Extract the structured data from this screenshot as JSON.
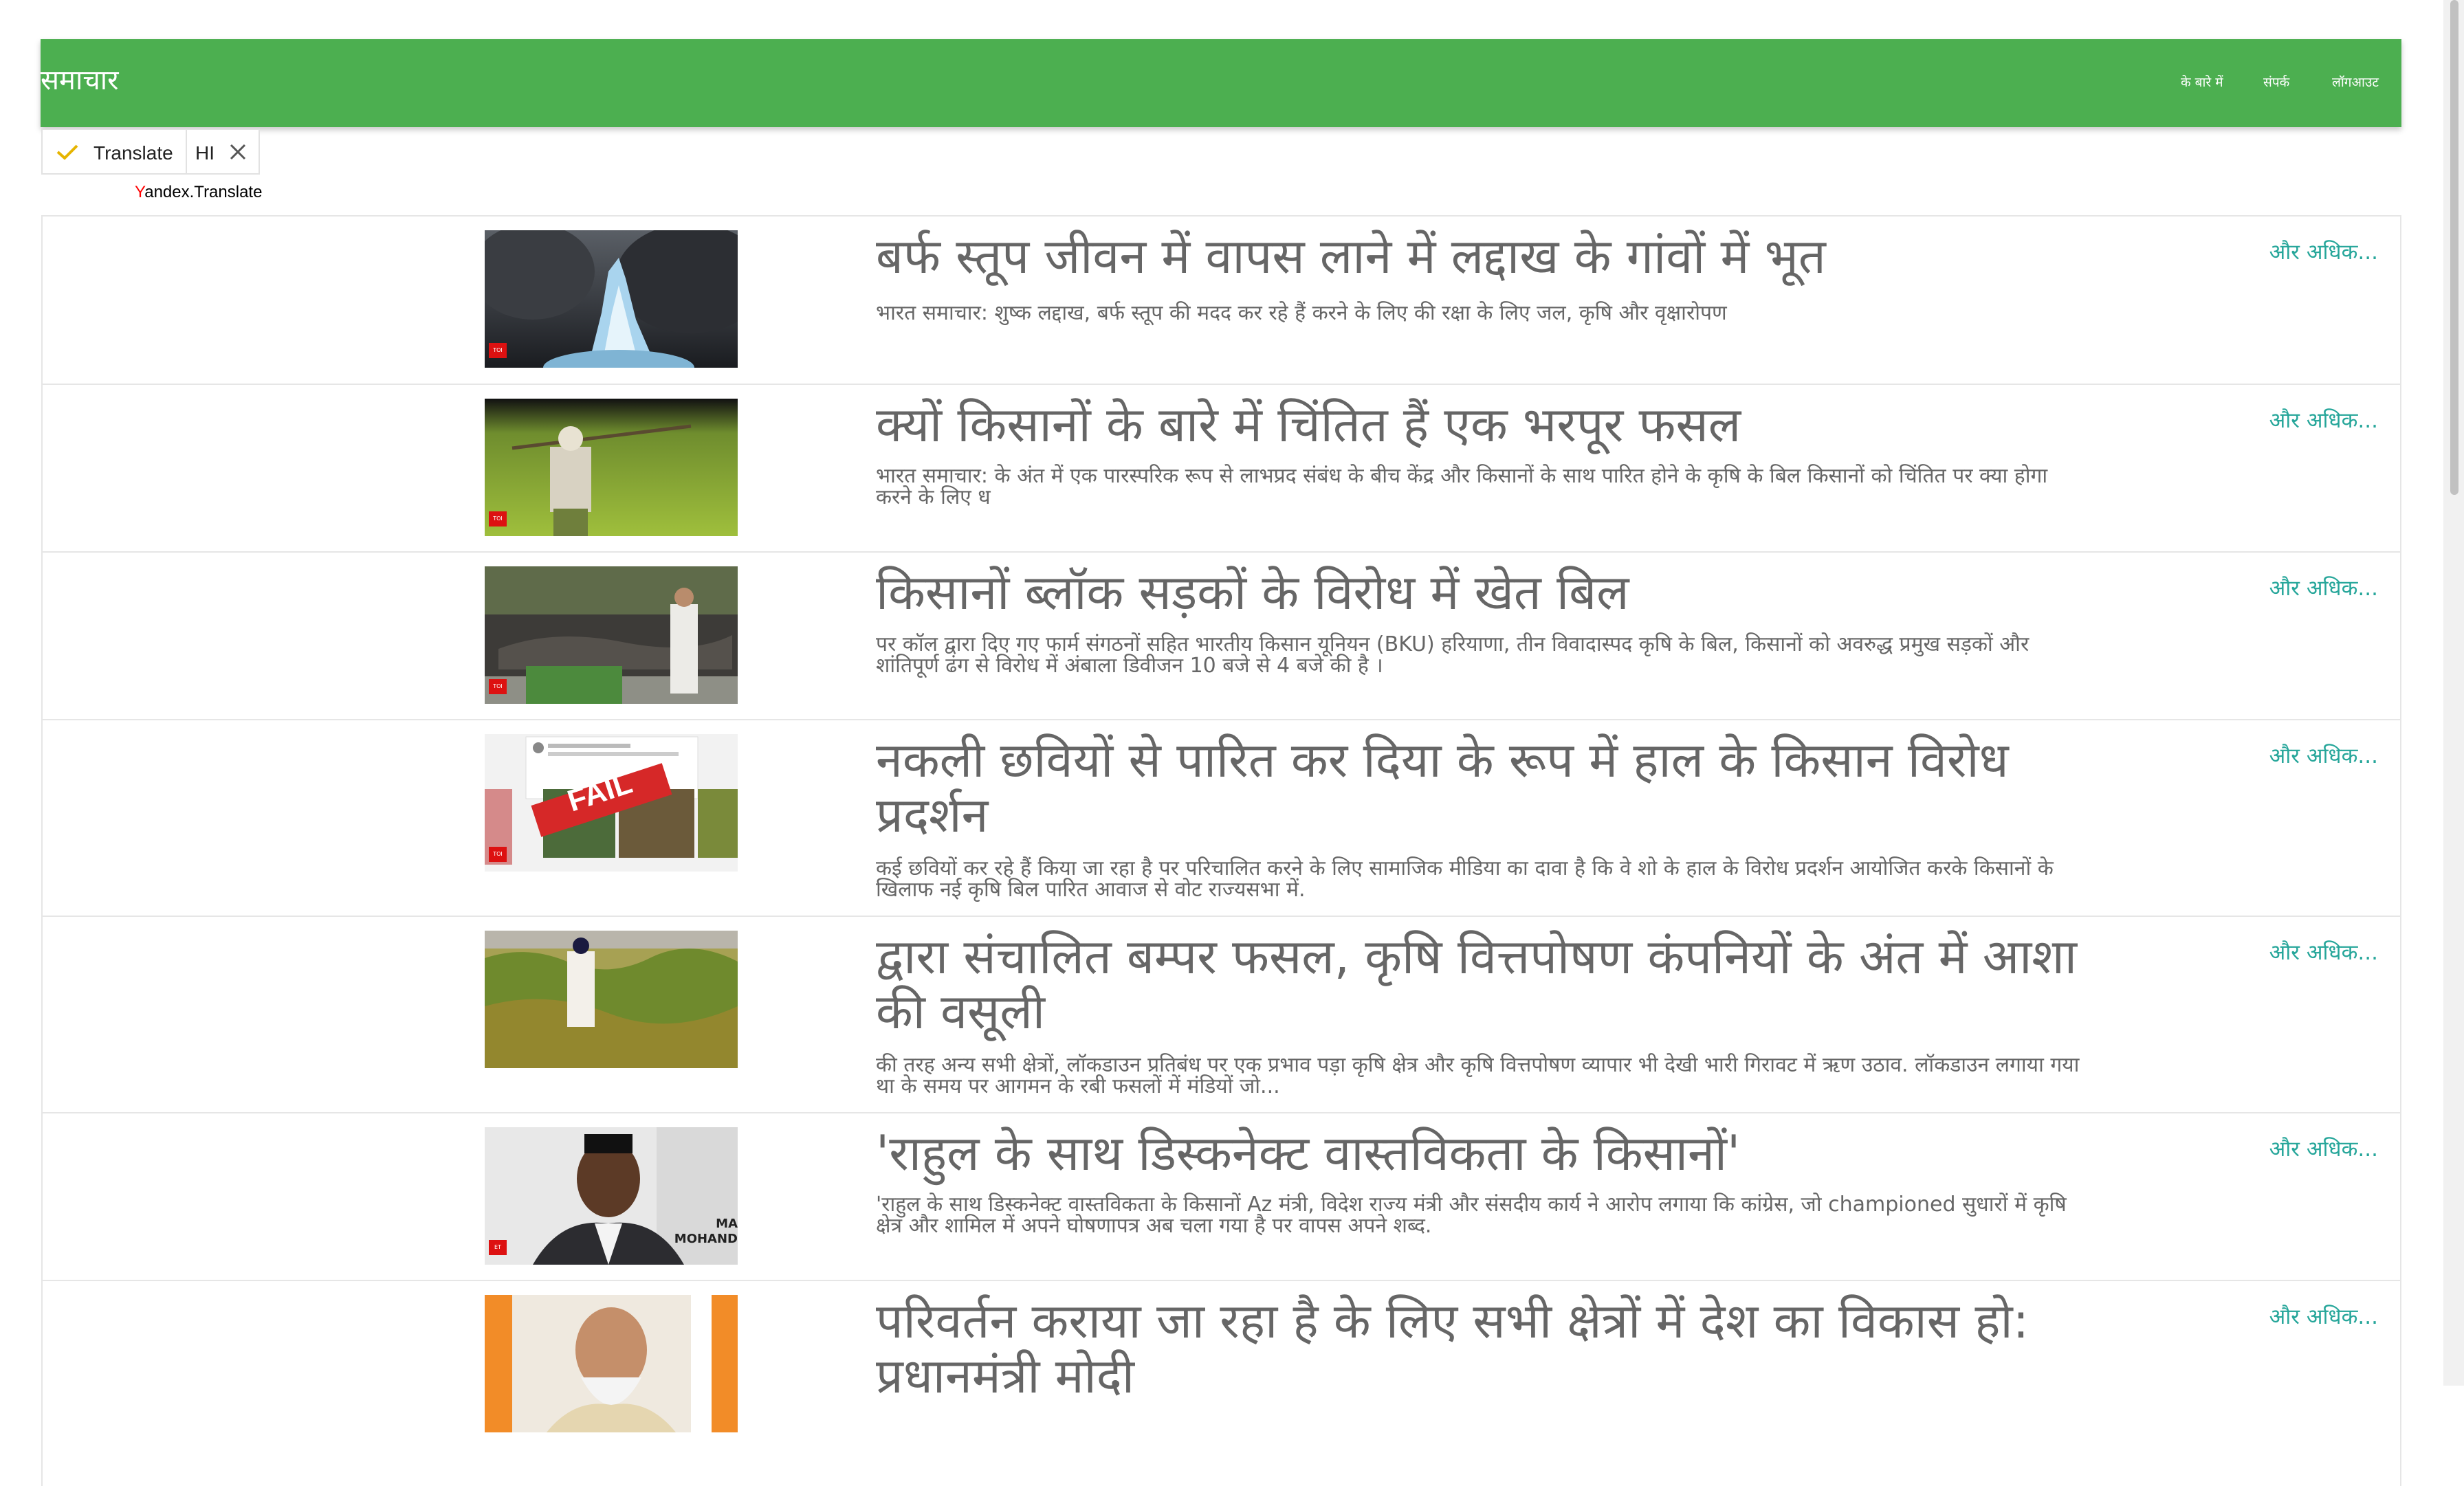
{
  "navbar": {
    "brand": "समाचार",
    "links": [
      "के बारे में",
      "संपर्क",
      "लॉगआउट"
    ]
  },
  "translate_widget": {
    "label": "Translate",
    "lang": "HI",
    "credit_prefix": "Y",
    "credit_rest": "andex.Translate"
  },
  "news": [
    {
      "title": "बर्फ स्तूप जीवन में वापस लाने में लद्दाख के गांवों में भूत",
      "summary": "भारत समाचार: शुष्क लद्दाख, बर्फ स्तूप की मदद कर रहे हैं करने के लिए की रक्षा के लिए जल, कृषि और वृक्षारोपण",
      "more": "और अधिक...",
      "badge": "TOI"
    },
    {
      "title": "क्यों किसानों के बारे में चिंतित हैं एक भरपूर फसल",
      "summary": "भारत समाचार: के अंत में एक पारस्परिक रूप से लाभप्रद संबंध के बीच केंद्र और किसानों के साथ पारित होने के कृषि के बिल किसानों को चिंतित पर क्या होगा करने के लिए ध",
      "more": "और अधिक...",
      "badge": "TOI"
    },
    {
      "title": "किसानों ब्लॉक सड़कों के विरोध में खेत बिल",
      "summary": "पर कॉल द्वारा दिए गए फार्म संगठनों सहित भारतीय किसान यूनियन (BKU) हरियाणा, तीन विवादास्पद कृषि के बिल, किसानों को अवरुद्ध प्रमुख सड़कों और शांतिपूर्ण ढंग से विरोध में अंबाला डिवीजन 10 बजे से 4 बजे की है ।",
      "more": "और अधिक...",
      "badge": "TOI"
    },
    {
      "title": "नकली छवियों से पारित कर दिया के रूप में हाल के किसान विरोध प्रदर्शन",
      "summary": "कई छवियों कर रहे हैं किया जा रहा है पर परिचालित करने के लिए सामाजिक मीडिया का दावा है कि वे शो के हाल के विरोध प्रदर्शन आयोजित करके किसानों के खिलाफ नई कृषि बिल पारित आवाज से वोट राज्यसभा में.",
      "more": "और अधिक...",
      "badge": "TOI",
      "stamp": "FAIL"
    },
    {
      "title": "द्वारा संचालित बम्पर फसल, कृषि वित्तपोषण कंपनियों के अंत में आशा की वसूली",
      "summary": "की तरह अन्य सभी क्षेत्रों, लॉकडाउन प्रतिबंध पर एक प्रभाव पड़ा कृषि क्षेत्र और कृषि वित्तपोषण व्यापार भी देखी भारी गिरावट में ऋण उठाव. लॉकडाउन लगाया गया था के समय पर आगमन के रबी फसलों में मंडियों जो...",
      "more": "और अधिक..."
    },
    {
      "title": "'राहुल के साथ डिस्कनेक्ट वास्तविकता के किसानों'",
      "summary": "'राहुल के साथ डिस्कनेक्ट वास्तविकता के किसानों Az मंत्री, विदेश राज्य मंत्री और संसदीय कार्य ने आरोप लगाया कि कांग्रेस, जो championed सुधारों में कृषि क्षेत्र और शामिल में अपने घोषणापत्र अब चला गया है पर वापस अपने शब्द.",
      "more": "और अधिक...",
      "badge": "ET",
      "caption": "MA\nMOHAND"
    },
    {
      "title": "परिवर्तन कराया जा रहा है के लिए सभी क्षेत्रों में देश का विकास हो: प्रधानमंत्री मोदी",
      "summary": "",
      "more": "और अधिक..."
    }
  ]
}
